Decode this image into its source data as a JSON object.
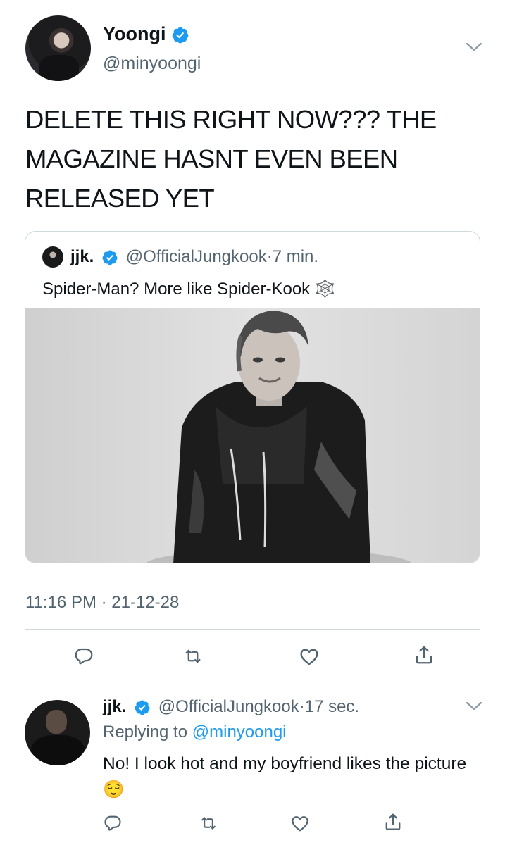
{
  "main_tweet": {
    "author_name": "Yoongi",
    "author_handle": "@minyoongi",
    "text": "DELETE THIS RIGHT NOW??? THE MAGAZINE HASNT EVEN BEEN RELEASED YET",
    "timestamp": "11:16 PM · 21-12-28",
    "verified": true
  },
  "quoted_tweet": {
    "author_name": "jjk.",
    "author_handle": "@OfficialJungkook",
    "separator": "·",
    "time": "7 min.",
    "text": "Spider-Man? More like Spider-Kook",
    "emoji": "🕸️"
  },
  "reply": {
    "author_name": "jjk.",
    "author_handle": "@OfficialJungkook",
    "separator": "·",
    "time": "17 sec.",
    "replying_to_label": "Replying to",
    "replying_to_handle": "@minyoongi",
    "text": "No! I look hot and my boyfriend likes the picture",
    "emoji": "😌"
  },
  "icons": {
    "verified": "verified-badge-icon",
    "more": "chevron-down-icon",
    "reply": "reply-icon",
    "retweet": "retweet-icon",
    "like": "heart-icon",
    "share": "share-icon"
  },
  "colors": {
    "verified_blue": "#1d9bf0",
    "secondary_text": "#536471",
    "mention_blue": "#1d9bf0",
    "divider": "#cfd9de"
  }
}
